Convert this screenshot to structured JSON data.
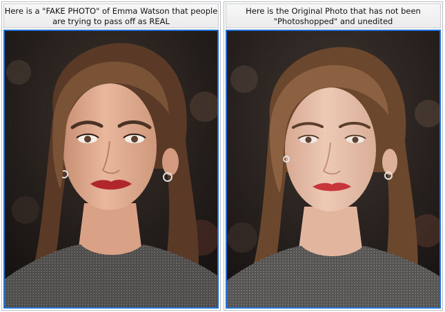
{
  "panels": [
    {
      "caption": "Here is a \"FAKE PHOTO\" of Emma Watson that people are trying to pass off as REAL",
      "variant": "edited",
      "colors": {
        "skin": "#e8b79c",
        "skin_shadow": "#c98f74",
        "lips": "#b0262a",
        "hair": "#5a3a26",
        "hair_light": "#7a5236",
        "top": "#4b4a48"
      }
    },
    {
      "caption": "Here is the Original Photo that has not been \"Photoshopped\" and unedited",
      "variant": "original",
      "colors": {
        "skin": "#edc9b4",
        "skin_shadow": "#d7a892",
        "lips": "#c8363b",
        "hair": "#6b472e",
        "hair_light": "#8c6142",
        "top": "#525150"
      }
    }
  ],
  "frame_color": "#1f6fd6"
}
